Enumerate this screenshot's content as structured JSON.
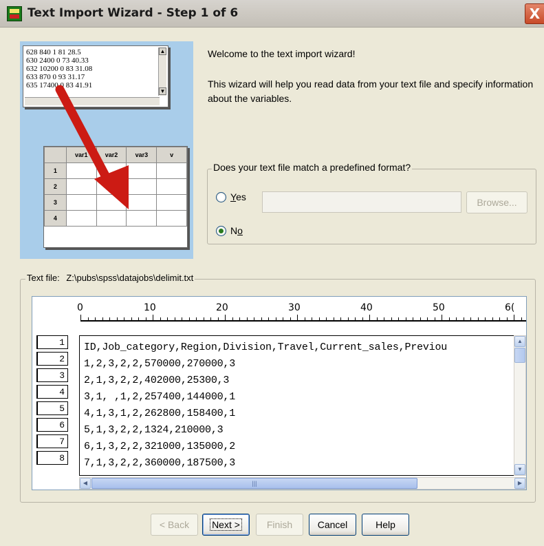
{
  "window": {
    "title": "Text Import Wizard - Step 1 of 6",
    "close_glyph": "X"
  },
  "illustration": {
    "text_lines": [
      "628 840 1 81 28.5",
      "630 2400 0 73 40.33",
      "632 10200 0 83 31.08",
      "633 870 0 93 31.17",
      "635 17400 0 83 41.91"
    ],
    "columns": [
      "var1",
      "var2",
      "var3",
      "v"
    ],
    "rows": [
      "1",
      "2",
      "3",
      "4"
    ]
  },
  "welcome": "Welcome to the text import wizard!",
  "intro": "This wizard will help you read data from your text file and specify information about the variables.",
  "predefined_group": {
    "legend": "Does your text file match a predefined format?",
    "yes_label": "Yes",
    "no_label": "No",
    "selected": "No",
    "path_value": "",
    "browse_label": "Browse..."
  },
  "text_file": {
    "label": "Text file:",
    "path": "Z:\\pubs\\spss\\datajobs\\delimit.txt"
  },
  "ruler": {
    "labels": [
      "0",
      "10",
      "20",
      "30",
      "40",
      "50",
      "6("
    ]
  },
  "preview": {
    "row_numbers": [
      "1",
      "2",
      "3",
      "4",
      "5",
      "6",
      "7",
      "8"
    ],
    "lines": [
      "ID,Job_category,Region,Division,Travel,Current_sales,Previou",
      "1,2,3,2,2,570000,270000,3",
      "2,1,3,2,2,402000,25300,3",
      "3,1, ,1,2,257400,144000,1",
      "4,1,3,1,2,262800,158400,1",
      "5,1,3,2,2,1324,210000,3",
      "6,1,3,2,2,321000,135000,2",
      "7,1,3,2,2,360000,187500,3"
    ]
  },
  "buttons": {
    "back": "< Back",
    "next": "Next >",
    "finish": "Finish",
    "cancel": "Cancel",
    "help": "Help"
  }
}
